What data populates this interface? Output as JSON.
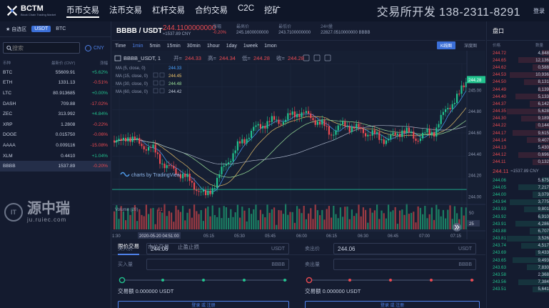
{
  "header": {
    "logo_title": "BCTM",
    "logo_sub": "Block Chain Trading Market",
    "nav": [
      "币币交易",
      "法币交易",
      "杠杆交易",
      "合约交易",
      "C2C",
      "挖矿"
    ],
    "promo": "交易所开发 138-2311-8291",
    "login": "登录"
  },
  "market": {
    "tabs": [
      "自选区",
      "USDT",
      "BTC"
    ],
    "search_placeholder": "搜索",
    "currency": "CNY",
    "headers": [
      "币种",
      "最新价 (CNY)",
      "涨幅"
    ],
    "rows": [
      {
        "coin": "BTC",
        "price": "55609.91",
        "change": "+5.62%",
        "dir": "up"
      },
      {
        "coin": "ETH",
        "price": "1331.13",
        "change": "-0.51%",
        "dir": "dn"
      },
      {
        "coin": "LTC",
        "price": "80.913685",
        "change": "+0.00%",
        "dir": "up"
      },
      {
        "coin": "DASH",
        "price": "709.88",
        "change": "-17.02%",
        "dir": "dn"
      },
      {
        "coin": "ZEC",
        "price": "313.992",
        "change": "+4.84%",
        "dir": "up"
      },
      {
        "coin": "XRP",
        "price": "1.2808",
        "change": "-0.22%",
        "dir": "dn"
      },
      {
        "coin": "DOGE",
        "price": "0.015750",
        "change": "-0.06%",
        "dir": "dn"
      },
      {
        "coin": "AAAA",
        "price": "0.009116",
        "change": "-15.08%",
        "dir": "dn"
      },
      {
        "coin": "XLM",
        "price": "0.4410",
        "change": "+1.04%",
        "dir": "up"
      },
      {
        "coin": "BBBB",
        "price": "1537.89",
        "change": "-0.20%",
        "dir": "dn"
      }
    ]
  },
  "watermark": {
    "cn": "源中瑞",
    "url": "ju.ruiec.com"
  },
  "ticker": {
    "pair": "BBBB / USDT",
    "price": "244.1100000000",
    "price_cny": "≈1537.89 CNY",
    "change_label": "涨幅",
    "change": "-0.20%",
    "high_label": "最高价",
    "high": "245.1600000000",
    "low_label": "最低价",
    "low": "243.7100000000",
    "vol_label": "24H量",
    "vol": "22827.0510000000 BBBB"
  },
  "chart_toolbar": {
    "intervals": [
      "Time",
      "1min",
      "5min",
      "15min",
      "30min",
      "1hour",
      "1day",
      "1week",
      "1mon"
    ],
    "active": "1min",
    "kline_btn": "K线图",
    "depth_btn": "深度图"
  },
  "chart_legend": {
    "symbol": "BBBB_USDT, 1",
    "open_lbl": "开=",
    "open": "244.33",
    "high_lbl": "高=",
    "high": "244.34",
    "low_lbl": "低=",
    "low": "244.28",
    "close_lbl": "收=",
    "close": "244.28",
    "ma": [
      {
        "label": "MA (5, close, 0)",
        "value": "244.33"
      },
      {
        "label": "MA (15, close, 0)",
        "value": "244.45"
      },
      {
        "label": "MA (30, close, 0)",
        "value": "244.48"
      },
      {
        "label": "MA (60, close, 0)",
        "value": "244.42"
      }
    ],
    "tv_label": "charts by TradingView",
    "volume_lbl": "Volume (20)",
    "volume_val": "61",
    "last_price": "244.28",
    "vol_tag": "25"
  },
  "chart_data": {
    "type": "candlestick",
    "ylim": [
      243.95,
      245.25
    ],
    "y_ticks": [
      "245.00",
      "244.80",
      "244.60",
      "244.40",
      "244.20",
      "244.00"
    ],
    "x_ticks": [
      "1:30",
      "2020-05-20 04:51:00",
      "05:15",
      "05:30",
      "05:45",
      "06:00",
      "06:15",
      "06:30",
      "06:45",
      "07:00",
      "07:15"
    ],
    "horizontal_line": 244.07,
    "volume_ticks": [
      "50",
      "25"
    ]
  },
  "order": {
    "tabs": [
      "限价交易",
      "市价交易",
      "止盈止损"
    ],
    "buy": {
      "price_lbl": "买入价",
      "price": "244.06",
      "unit": "USDT",
      "qty_lbl": "买入量",
      "qty_unit": "BBBB",
      "total_lbl": "交易额",
      "total": "0.000000 USDT",
      "button": "登录 或 注册"
    },
    "sell": {
      "price_lbl": "卖出价",
      "price": "244.06",
      "unit": "USDT",
      "qty_lbl": "卖出量",
      "qty_unit": "BBBB",
      "total_lbl": "交易额",
      "total": "0.000000 USDT",
      "button": "登录 或 注册"
    }
  },
  "orderbook": {
    "title": "盘口",
    "headers": [
      "价格",
      "数量"
    ],
    "asks": [
      [
        "244.72",
        "4,848"
      ],
      [
        "244.65",
        "12,136"
      ],
      [
        "244.62",
        "0,588"
      ],
      [
        "244.53",
        "10,936"
      ],
      [
        "244.50",
        "8,131"
      ],
      [
        "244.49",
        "8,139"
      ],
      [
        "244.40",
        "5,133"
      ],
      [
        "244.37",
        "6,142"
      ],
      [
        "244.35",
        "5,628"
      ],
      [
        "244.30",
        "9,189"
      ],
      [
        "244.22",
        "0,144"
      ],
      [
        "244.17",
        "9,615"
      ],
      [
        "244.14",
        "9,407"
      ],
      [
        "244.13",
        "5,430"
      ],
      [
        "244.12",
        "0,696"
      ],
      [
        "244.11",
        "0,132"
      ]
    ],
    "last": "244.11",
    "last_cny": "≈1537.89 CNY",
    "bids": [
      [
        "244.06",
        "5,675"
      ],
      [
        "244.05",
        "7,217"
      ],
      [
        "244.00",
        "3,079"
      ],
      [
        "243.94",
        "3,775"
      ],
      [
        "243.93",
        "9,801"
      ],
      [
        "243.92",
        "6,910"
      ],
      [
        "243.91",
        "4,286"
      ],
      [
        "243.88",
        "6,707"
      ],
      [
        "243.81",
        "3,526"
      ],
      [
        "243.74",
        "4,517"
      ],
      [
        "243.69",
        "9,433"
      ],
      [
        "243.65",
        "9,493"
      ],
      [
        "243.63",
        "7,830"
      ],
      [
        "243.58",
        "2,368"
      ],
      [
        "243.56",
        "7,384"
      ],
      [
        "243.51",
        "5,641"
      ]
    ]
  },
  "colors": {
    "up": "#22c38e",
    "down": "#ec4b52",
    "accent": "#3b6fd8",
    "bg": "#151c30"
  }
}
